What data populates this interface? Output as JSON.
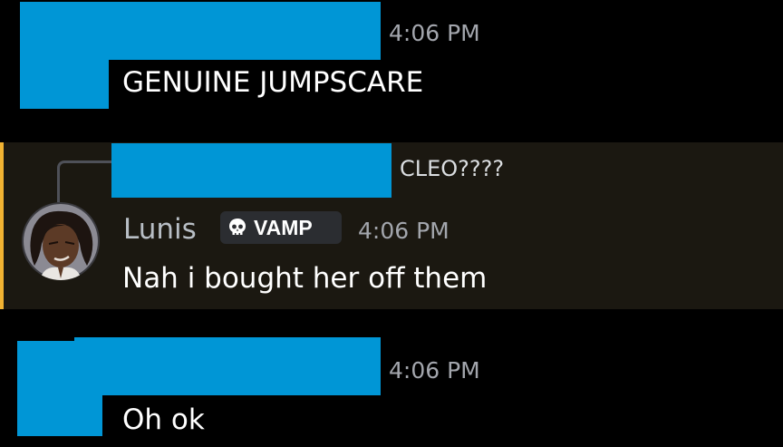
{
  "messages": [
    {
      "timestamp": "4:06 PM",
      "text": "GENUINE JUMPSCARE"
    },
    {
      "reply_preview": "CLEO????",
      "author": "Lunis",
      "role_tag": "VAMP",
      "role_icon": "skull-icon",
      "timestamp": "4:06 PM",
      "text": "Nah i bought her off them"
    },
    {
      "timestamp": "4:06 PM",
      "text": "Oh ok"
    }
  ],
  "colors": {
    "background": "#000000",
    "redaction": "#0096d6",
    "highlight_background": "#1b1811",
    "highlight_bar": "#f0b232",
    "timestamp": "#a3a6ad",
    "message_text": "#ffffff",
    "username": "#b8bec5"
  }
}
